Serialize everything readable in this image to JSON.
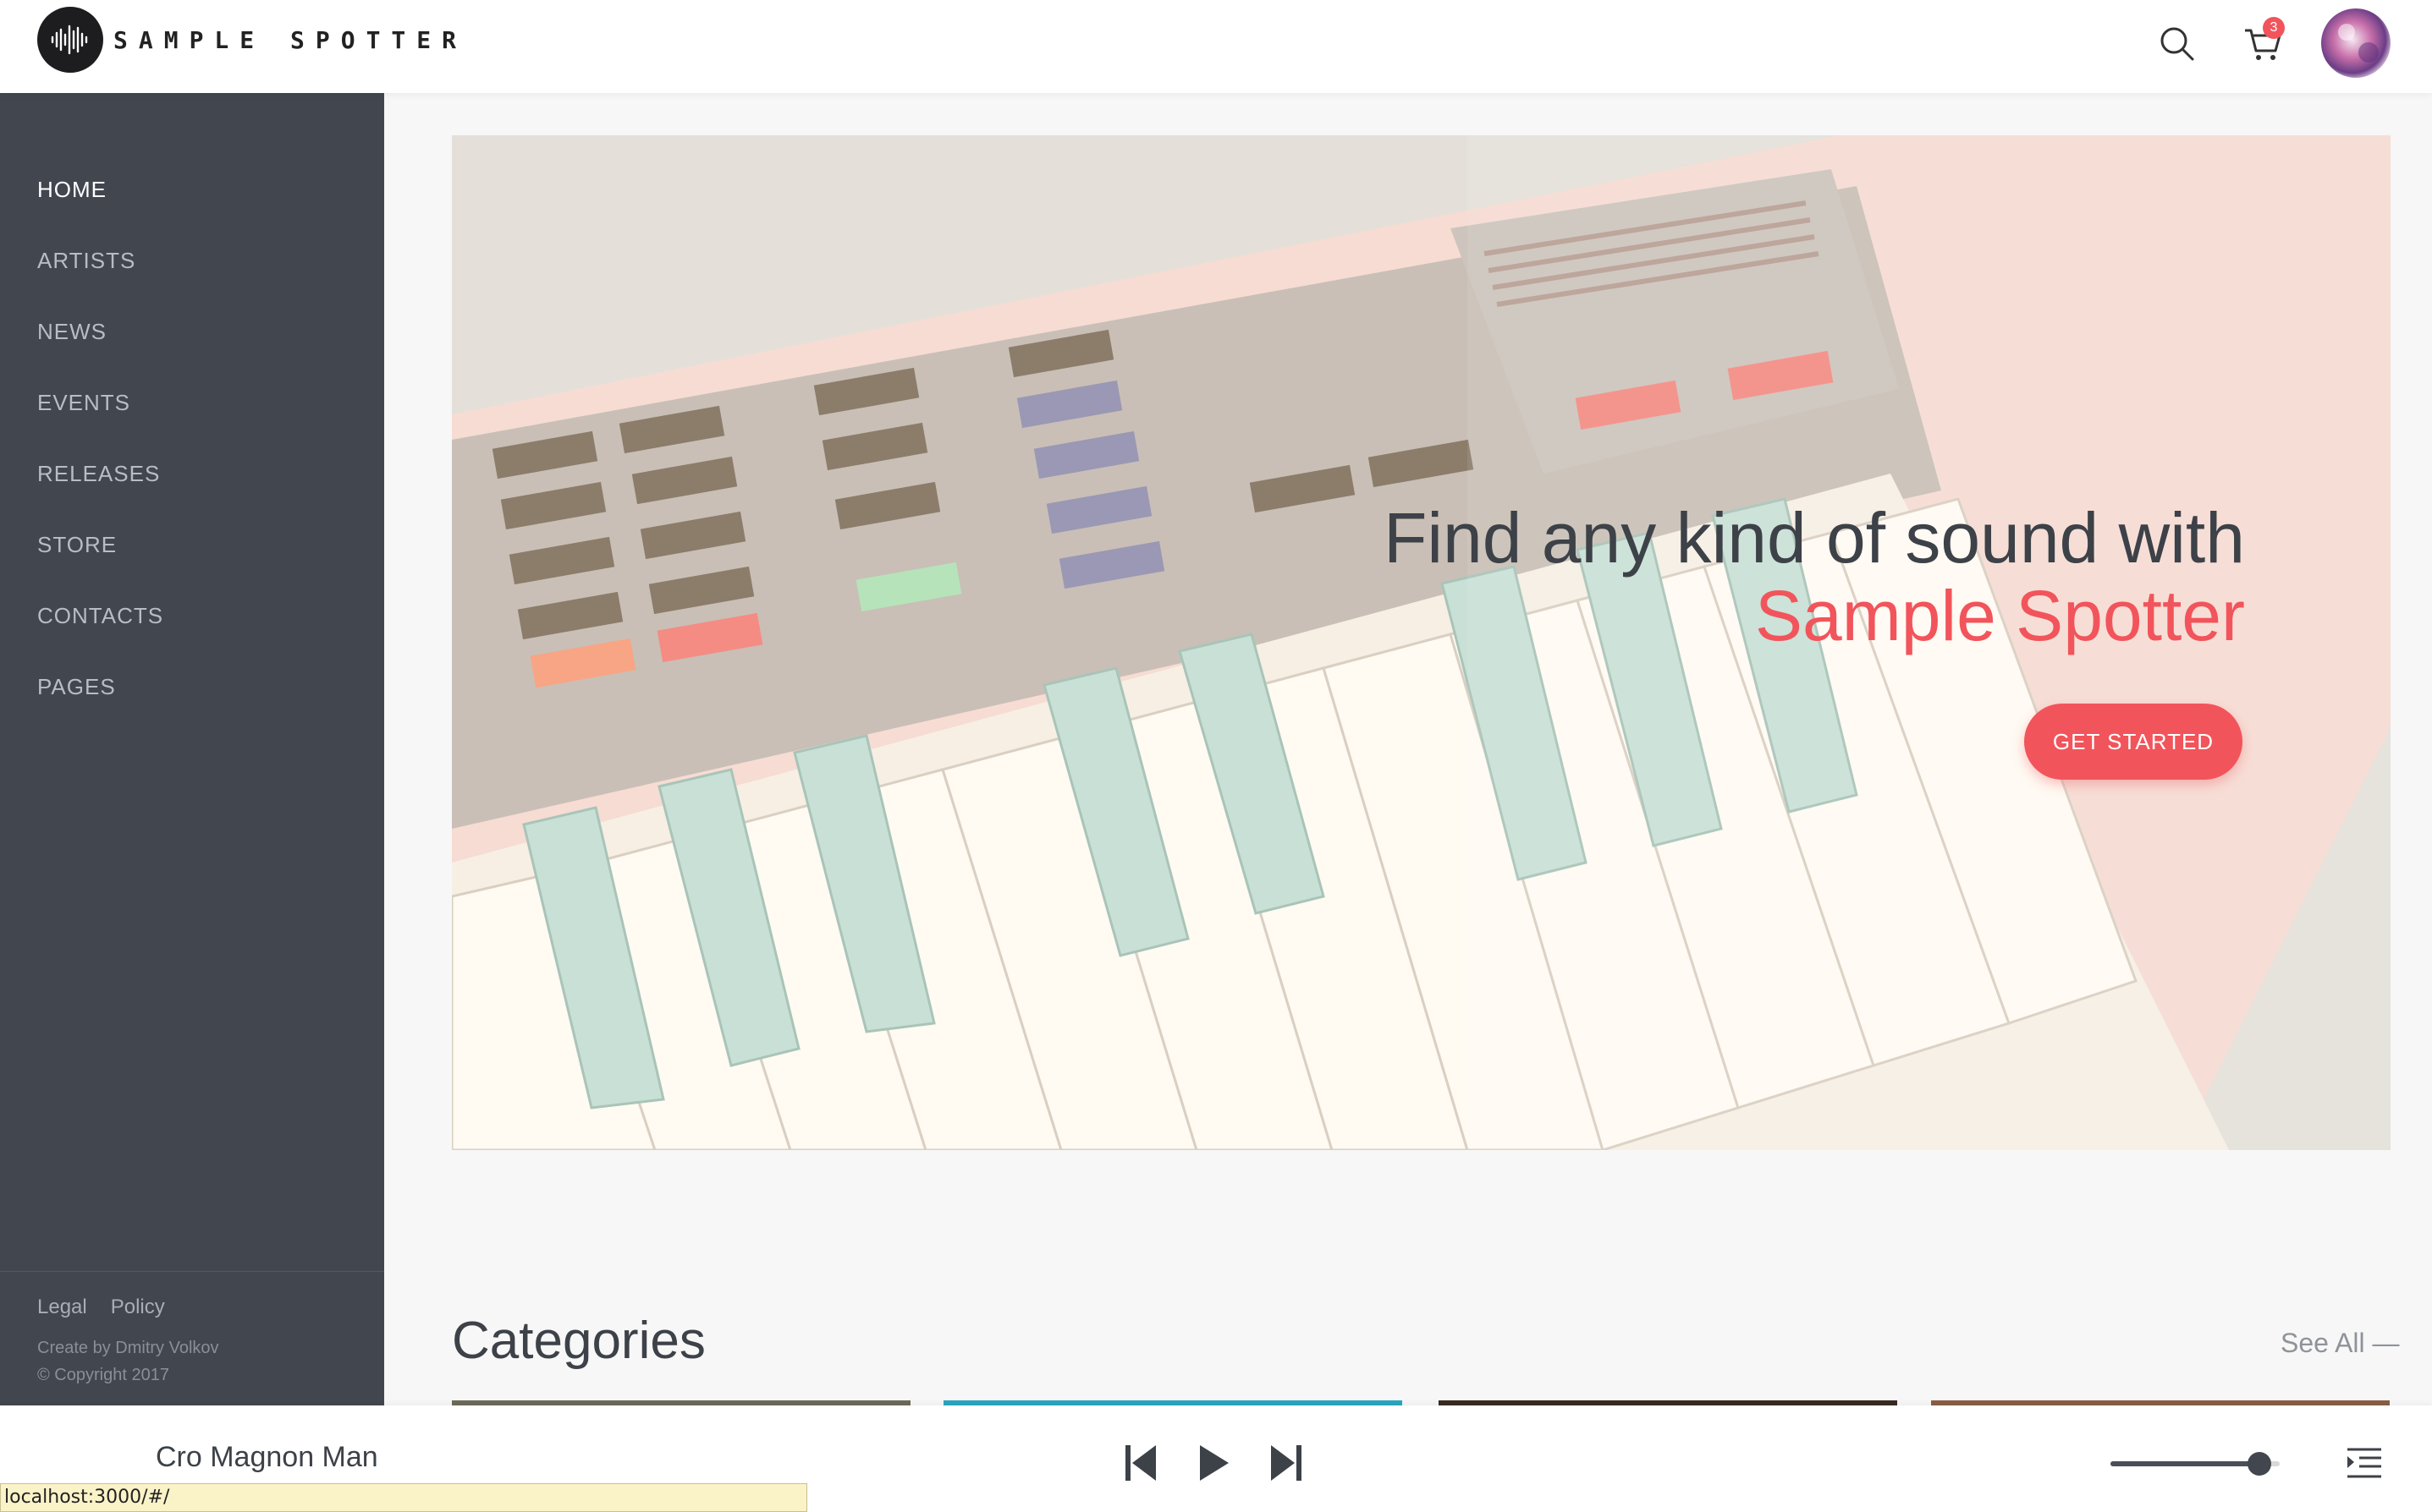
{
  "brand": {
    "name": "SAMPLE SPOTTER"
  },
  "header": {
    "cart_count": "3"
  },
  "sidebar": {
    "items": [
      {
        "label": "HOME"
      },
      {
        "label": "ARTISTS"
      },
      {
        "label": "NEWS"
      },
      {
        "label": "EVENTS"
      },
      {
        "label": "RELEASES"
      },
      {
        "label": "STORE"
      },
      {
        "label": "CONTACTS"
      },
      {
        "label": "PAGES"
      }
    ],
    "active_item": "HOME",
    "legal": "Legal",
    "policy": "Policy",
    "credit": "Create by Dmitry Volkov",
    "copyright": "© Copyright 2017"
  },
  "hero": {
    "title_line1": "Find any kind of sound with",
    "title_line2": "Sample Spotter",
    "cta": "GET STARTED"
  },
  "categories": {
    "title": "Categories",
    "see_all": "See All —"
  },
  "player": {
    "track_title": "Cro Magnon Man",
    "volume_fraction": 0.88
  },
  "status_bar": {
    "url": "localhost:3000/#/"
  },
  "colors": {
    "accent": "#f2545b",
    "sidebar_bg": "#42464f",
    "text_dark": "#3d4148"
  }
}
